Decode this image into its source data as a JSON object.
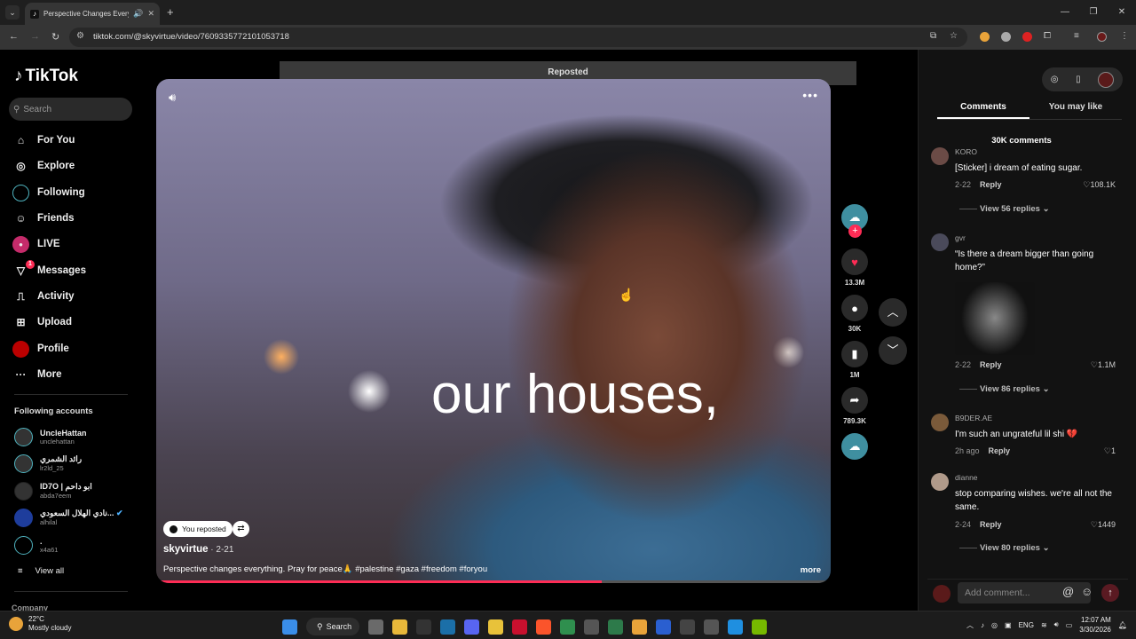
{
  "browser": {
    "tab_title": "Perspective Changes Everyth",
    "url": "tiktok.com/@skyvirtue/video/7609335772101053718",
    "new_tab": "+"
  },
  "sidebar": {
    "logo": "TikTok",
    "search_placeholder": "Search",
    "items": [
      {
        "label": "For You",
        "icon": "home-icon"
      },
      {
        "label": "Explore",
        "icon": "compass-icon"
      },
      {
        "label": "Following",
        "icon": "following-icon"
      },
      {
        "label": "Friends",
        "icon": "friends-icon"
      },
      {
        "label": "LIVE",
        "icon": "live-icon"
      },
      {
        "label": "Messages",
        "icon": "messages-icon",
        "badge": "1"
      },
      {
        "label": "Activity",
        "icon": "activity-icon"
      },
      {
        "label": "Upload",
        "icon": "upload-icon"
      },
      {
        "label": "Profile",
        "icon": "profile-icon"
      },
      {
        "label": "More",
        "icon": "more-icon"
      }
    ],
    "following_title": "Following accounts",
    "accounts": [
      {
        "name": "UncleHattan",
        "handle": "unclehattan"
      },
      {
        "name": "رائد الشمري",
        "handle": "lr2ld_25"
      },
      {
        "name": "ID7O | ابو داحم",
        "handle": "abda7eem"
      },
      {
        "name": "نادي الهلال السعودي...",
        "handle": "alhilal"
      },
      {
        "name": ".",
        "handle": "x4a61"
      }
    ],
    "view_all": "View all",
    "company": "Company"
  },
  "video": {
    "banner": "Reposted",
    "caption_overlay": "our houses,",
    "you_reposted": "You reposted",
    "author": "skyvirtue",
    "date": " · 2-21",
    "description": "Perspective changes everything. Pray for peace🙏 #palestine #gaza #freedom #foryou",
    "more": "more",
    "progress": 0.66
  },
  "actions": {
    "likes": "13.3M",
    "comments": "30K",
    "saves": "1M",
    "shares": "789.3K"
  },
  "panel": {
    "tabs": [
      "Comments",
      "You may like"
    ],
    "comment_count": "30K comments",
    "comments": [
      {
        "user": "KORO",
        "text": "[Sticker] i dream of eating sugar.",
        "date": "2-22",
        "reply": "Reply",
        "likes": "108.1K",
        "view_replies": "View 56 replies"
      },
      {
        "user": "gvr",
        "text": "“Is there a dream bigger than going home?”",
        "date": "2-22",
        "reply": "Reply",
        "likes": "1.1M",
        "view_replies": "View 86 replies"
      },
      {
        "user": "B9DER.AE",
        "text": "I'm such an ungrateful lil shi 💔",
        "date": "2h ago",
        "reply": "Reply",
        "likes": "1"
      },
      {
        "user": "dianne",
        "text": "stop comparing wishes. we're all not the same.",
        "date": "2-24",
        "reply": "Reply",
        "likes": "1449",
        "view_replies": "View 80 replies"
      }
    ],
    "add_comment": "Add comment..."
  },
  "taskbar": {
    "temp": "22°C",
    "weather": "Mostly cloudy",
    "search": "Search",
    "lang": "ENG",
    "time": "12:07 AM",
    "date": "3/30/2026"
  }
}
